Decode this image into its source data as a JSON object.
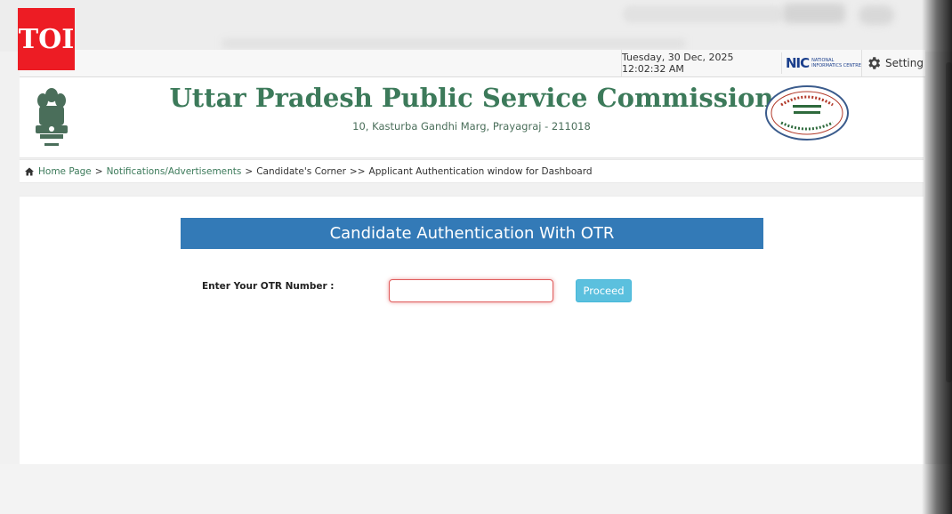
{
  "watermark": {
    "logo_text": "TOI"
  },
  "topbar": {
    "datetime": "Tuesday, 30 Dec, 2025 12:02:32 AM",
    "nic_mark": "NIC",
    "nic_text": "NATIONAL INFORMATICS CENTRE",
    "setting_label": "Setting"
  },
  "header": {
    "title": "Uttar Pradesh Public Service Commission",
    "address": "10, Kasturba Gandhi Marg, Prayagraj - 211018",
    "emblem_icon": "national-emblem-icon",
    "seal_icon": "commission-seal-icon"
  },
  "breadcrumb": {
    "home": "Home Page",
    "sep1": ">",
    "notifications": "Notifications/Advertisements",
    "sep2": ">",
    "candidates_corner": "Candidate's Corner",
    "sep3": ">>",
    "current": "Applicant Authentication window for Dashboard"
  },
  "form": {
    "heading": "Candidate Authentication With OTR",
    "otr_label": "Enter Your OTR Number :",
    "otr_value": "",
    "proceed_label": "Proceed"
  },
  "colors": {
    "brand_green": "#3c7a5a",
    "heading_blue": "#337ab7",
    "button_info": "#5bc0de",
    "input_error": "#e05a5a",
    "toi_red": "#ed1c24"
  }
}
